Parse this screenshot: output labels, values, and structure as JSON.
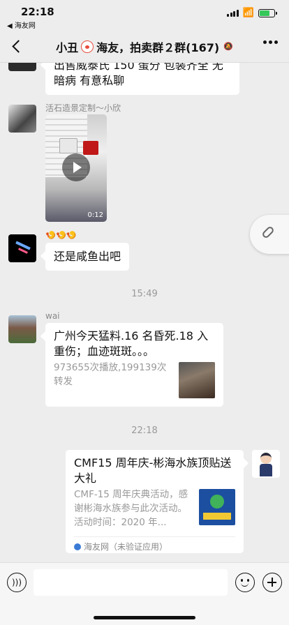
{
  "status": {
    "time": "22:18",
    "back_app": "◀ 海友网"
  },
  "nav": {
    "title_prefix": "小丑",
    "title_suffix": "海友，拍卖群２群(167)"
  },
  "messages": [
    {
      "text": "出售威泰氏 150 蛋分  包装齐全 无暗病 有意私聊"
    },
    {
      "sender": "活石造景定制～小欣",
      "video_duration": "0:12"
    },
    {
      "sender": "🍤🍤🍤",
      "text": "还是咸鱼出吧"
    },
    {
      "time": "15:49"
    },
    {
      "sender": "wai",
      "title": "广州今天猛料.16 名昏死.18 入重伤；血迹斑斑。。。",
      "desc": "973655次播放,199139次转发"
    },
    {
      "time": "22:18"
    },
    {
      "title": "CMF15 周年庆-彬海水族顶贴送大礼",
      "desc": "CMF-15 周年庆典活动，感谢彬海水族参与此次活动。活动时间：2020 年...",
      "source": "海友网（未验证应用）"
    }
  ],
  "input": {
    "placeholder": ""
  },
  "colors": {
    "background": "#ededed",
    "bubble": "#ffffff",
    "battery": "#35c759"
  }
}
